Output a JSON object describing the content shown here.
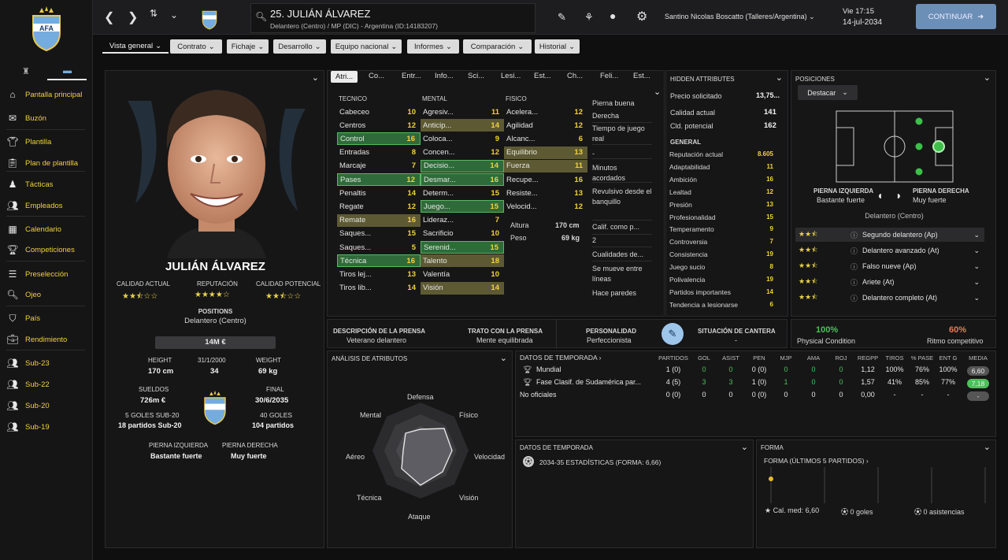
{
  "topbar": {
    "player_name": "25. JULIÁN ÁLVAREZ",
    "player_sub": "Delantero (Centro) / MP (DIC) - Argentina (ID:14183207)",
    "manager": "Santino Nicolas Boscatto (Talleres/Argentina)",
    "day_time": "Vie 17:15",
    "date": "14-jul-2034",
    "continue_label": "CONTINUAR"
  },
  "sidebar": {
    "items": [
      {
        "label": "Pantalla principal",
        "icon": "home-icon"
      },
      {
        "label": "Buzón",
        "icon": "inbox-icon"
      },
      {
        "label": "Plantilla",
        "icon": "shirt-icon"
      },
      {
        "label": "Plan de plantilla",
        "icon": "clipboard-icon"
      },
      {
        "label": "Tácticas",
        "icon": "tactics-icon"
      },
      {
        "label": "Empleados",
        "icon": "staff-icon"
      },
      {
        "label": "Calendario",
        "icon": "calendar-icon"
      },
      {
        "label": "Competiciones",
        "icon": "trophy-icon"
      },
      {
        "label": "Preselección",
        "icon": "list-icon"
      },
      {
        "label": "Ojeo",
        "icon": "search-icon"
      },
      {
        "label": "País",
        "icon": "shield-icon"
      },
      {
        "label": "Rendimiento",
        "icon": "briefcase-icon"
      },
      {
        "label": "Sub-23",
        "icon": "group-icon"
      },
      {
        "label": "Sub-22",
        "icon": "group-icon"
      },
      {
        "label": "Sub-20",
        "icon": "group-icon"
      },
      {
        "label": "Sub-19",
        "icon": "group-icon"
      }
    ]
  },
  "tabs": [
    "Vista general",
    "Contrato",
    "Fichaje",
    "Desarrollo",
    "Equipo nacional",
    "Informes",
    "Comparación",
    "Historial"
  ],
  "profile": {
    "name": "JULIÁN ÁLVAREZ",
    "ca_label": "CALIDAD ACTUAL",
    "rep_label": "REPUTACIÓN",
    "cp_label": "CALIDAD POTENCIAL",
    "ca_stars": 2.5,
    "rep_stars": 4,
    "cp_stars": 2.5,
    "positions_label": "POSITIONS",
    "positions_value": "Delantero (Centro)",
    "value": "14M €",
    "height_label": "HEIGHT",
    "height": "170 cm",
    "dob": "31/1/2000",
    "age": "34",
    "weight_label": "WEIGHT",
    "weight": "69 kg",
    "wages_label": "SUELDOS",
    "wages": "726m €",
    "end_label": "FINAL",
    "end_date": "30/6/2035",
    "u20_goals": "5 GOLES SUB-20",
    "u20_apps": "18 partidos Sub-20",
    "int_goals": "40 GOLES",
    "int_apps": "104 partidos",
    "left_foot_label": "PIERNA IZQUIERDA",
    "left_foot": "Bastante fuerte",
    "right_foot_label": "PIERNA DERECHA",
    "right_foot": "Muy fuerte"
  },
  "attr_tabs": [
    "Atri...",
    "Co...",
    "Entr...",
    "Info...",
    "Sci...",
    "Lesi...",
    "Est...",
    "Ch...",
    "Feli...",
    "Est..."
  ],
  "attributes": {
    "tecnico_label": "TECNICO",
    "mental_label": "MENTAL",
    "fisico_label": "FISICO",
    "tecnico": [
      {
        "n": "Cabeceo",
        "v": "10",
        "h": ""
      },
      {
        "n": "Centros",
        "v": "12",
        "h": ""
      },
      {
        "n": "Control",
        "v": "16",
        "h": "g"
      },
      {
        "n": "Entradas",
        "v": "8",
        "h": ""
      },
      {
        "n": "Marcaje",
        "v": "7",
        "h": ""
      },
      {
        "n": "Pases",
        "v": "12",
        "h": "g"
      },
      {
        "n": "Penaltis",
        "v": "14",
        "h": ""
      },
      {
        "n": "Regate",
        "v": "12",
        "h": ""
      },
      {
        "n": "Remate",
        "v": "16",
        "h": "y"
      },
      {
        "n": "Saques...",
        "v": "15",
        "h": ""
      },
      {
        "n": "Saques...",
        "v": "5",
        "h": ""
      },
      {
        "n": "Técnica",
        "v": "16",
        "h": "g"
      },
      {
        "n": "Tiros lej...",
        "v": "13",
        "h": ""
      },
      {
        "n": "Tiros lib...",
        "v": "14",
        "h": ""
      }
    ],
    "mental": [
      {
        "n": "Agresiv...",
        "v": "11",
        "h": ""
      },
      {
        "n": "Anticip...",
        "v": "14",
        "h": "y"
      },
      {
        "n": "Coloca...",
        "v": "9",
        "h": ""
      },
      {
        "n": "Concen...",
        "v": "12",
        "h": ""
      },
      {
        "n": "Decisio...",
        "v": "14",
        "h": "g"
      },
      {
        "n": "Desmar...",
        "v": "16",
        "h": "g"
      },
      {
        "n": "Determ...",
        "v": "15",
        "h": ""
      },
      {
        "n": "Juego...",
        "v": "15",
        "h": "g"
      },
      {
        "n": "Lideraz...",
        "v": "7",
        "h": ""
      },
      {
        "n": "Sacrificio",
        "v": "10",
        "h": ""
      },
      {
        "n": "Serenid...",
        "v": "15",
        "h": "g"
      },
      {
        "n": "Talento",
        "v": "18",
        "h": "y"
      },
      {
        "n": "Valentía",
        "v": "10",
        "h": ""
      },
      {
        "n": "Visión",
        "v": "14",
        "h": "y"
      }
    ],
    "fisico": [
      {
        "n": "Acelera...",
        "v": "12",
        "h": ""
      },
      {
        "n": "Agilidad",
        "v": "12",
        "h": ""
      },
      {
        "n": "Alcanc...",
        "v": "6",
        "h": ""
      },
      {
        "n": "Equilibrio",
        "v": "13",
        "h": "y"
      },
      {
        "n": "Fuerza",
        "v": "11",
        "h": "y"
      },
      {
        "n": "Recupe...",
        "v": "16",
        "h": ""
      },
      {
        "n": "Resiste...",
        "v": "13",
        "h": ""
      },
      {
        "n": "Velocid...",
        "v": "12",
        "h": ""
      }
    ],
    "altura_label": "Altura",
    "altura": "170 cm",
    "peso_label": "Peso",
    "peso": "69 kg",
    "extras": [
      "Pierna buena",
      "Derecha",
      "Tiempo de juego real",
      "-",
      "Minutos acordados",
      "Revulsivo desde el banquillo",
      "Calif. como p...",
      "2",
      "Cualidades de...",
      "Se mueve entre líneas",
      "Hace paredes"
    ]
  },
  "hidden": {
    "title": "HIDDEN ATTRIBUTES",
    "asking_label": "Precio solicitado",
    "asking": "13,75...",
    "ca_label": "Calidad actual",
    "ca": "141",
    "pa_label": "Cld. potencial",
    "pa": "162",
    "general_label": "GENERAL",
    "rows": [
      {
        "n": "Reputación actual",
        "v": "8.605"
      },
      {
        "n": "Adaptabilidad",
        "v": "11"
      },
      {
        "n": "Ambición",
        "v": "16"
      },
      {
        "n": "Lealtad",
        "v": "12"
      },
      {
        "n": "Presión",
        "v": "13"
      },
      {
        "n": "Profesionalidad",
        "v": "15"
      },
      {
        "n": "Temperamento",
        "v": "9"
      },
      {
        "n": "Controversia",
        "v": "7"
      },
      {
        "n": "Consistencia",
        "v": "19"
      },
      {
        "n": "Juego sucio",
        "v": "8"
      },
      {
        "n": "Polivalencia",
        "v": "19"
      },
      {
        "n": "Partidos importantes",
        "v": "14"
      },
      {
        "n": "Tendencia a lesionarse",
        "v": "6"
      }
    ]
  },
  "positions": {
    "title": "POSICIONES",
    "highlight": "Destacar",
    "left_label": "PIERNA IZQUIERDA",
    "left": "Bastante fuerte",
    "right_label": "PIERNA DERECHA",
    "right": "Muy fuerte",
    "role": "Delantero (Centro)",
    "roles": [
      {
        "n": "Segundo delantero (Ap)",
        "s": 2.5
      },
      {
        "n": "Delantero avanzado (At)",
        "s": 2.5
      },
      {
        "n": "Falso nueve (Ap)",
        "s": 2.5
      },
      {
        "n": "Ariete (At)",
        "s": 2.5
      },
      {
        "n": "Delantero completo (At)",
        "s": 2.5
      }
    ]
  },
  "press": {
    "desc_label": "DESCRIPCIÓN DE LA PRENSA",
    "desc": "Veterano delantero",
    "trato_label": "TRATO CON LA PRENSA",
    "trato": "Mente equilibrada",
    "pers_label": "PERSONALIDAD",
    "pers": "Perfeccionista",
    "cantera_label": "SITUACIÓN DE CANTERA",
    "cantera": "-",
    "phys_pct": "100%",
    "phys_label": "Physical Condition",
    "ritmo_pct": "60%",
    "ritmo_label": "Ritmo competitivo"
  },
  "analysis": {
    "title": "ANÁLISIS DE ATRIBUTOS",
    "axes": [
      "Defensa",
      "Físico",
      "Velocidad",
      "Visión",
      "Ataque",
      "Técnica",
      "Aéreo",
      "Mental"
    ]
  },
  "season": {
    "title": "DATOS DE TEMPORADA",
    "headers": [
      "PARTIDOS",
      "GOL",
      "ASIST",
      "PEN",
      "MJP",
      "AMA",
      "ROJ",
      "REGPP",
      "TIROS",
      "% PASE",
      "ENT G",
      "MEDIA"
    ],
    "rows": [
      {
        "comp": "Mundial",
        "vals": [
          "1 (0)",
          "0",
          "0",
          "0 (0)",
          "0",
          "0",
          "0",
          "1,12",
          "100%",
          "76%",
          "100%"
        ],
        "media": "6,60"
      },
      {
        "comp": "Fase Clasif. de Sudamérica par...",
        "vals": [
          "4 (5)",
          "3",
          "3",
          "1 (0)",
          "1",
          "0",
          "0",
          "1,57",
          "41%",
          "85%",
          "77%"
        ],
        "media": "7,18"
      },
      {
        "comp": "No oficiales",
        "vals": [
          "0 (0)",
          "0",
          "0",
          "0 (0)",
          "0",
          "0",
          "0",
          "0,00",
          "-",
          "-",
          "-"
        ],
        "media": "-"
      }
    ]
  },
  "season2": {
    "title": "DATOS DE TEMPORADA",
    "line": "2034-35 ESTADÍSTICAS (FORMA: 6,66)"
  },
  "form": {
    "title": "FORMA",
    "sub": "FORMA (ÚLTIMOS 5 PARTIDOS)",
    "avg": "Cal. med: 6,60",
    "goals": "0 goles",
    "assists": "0 asistencias"
  }
}
